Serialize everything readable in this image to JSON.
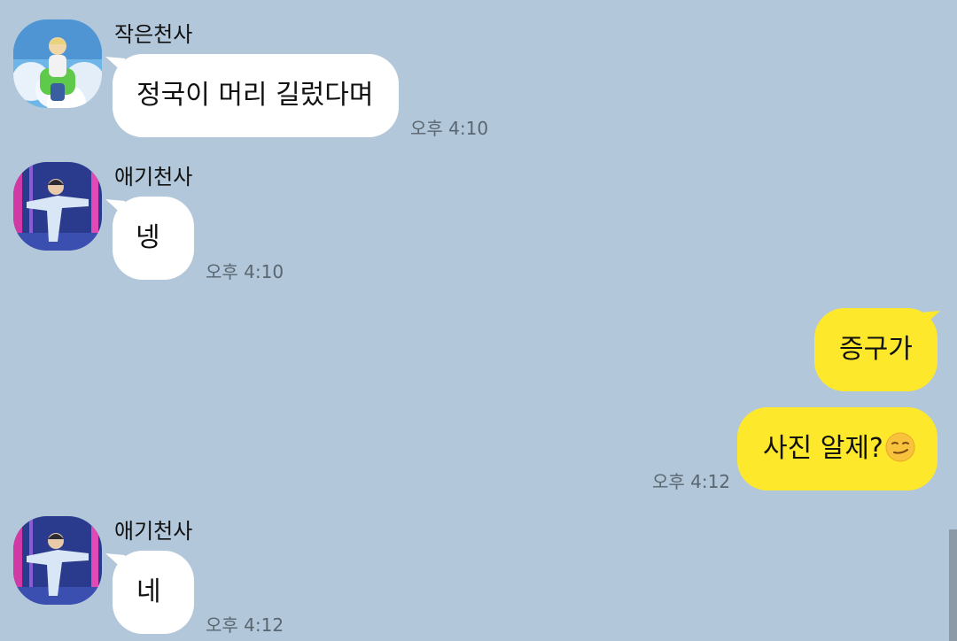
{
  "colors": {
    "background": "#b2c7d9",
    "incoming_bubble": "#ffffff",
    "outgoing_bubble": "#fee82c",
    "time_text": "#5a6670"
  },
  "messages": [
    {
      "sender": "작은천사",
      "text": "정국이 머리 길렀다며",
      "time": "오후 4:10",
      "direction": "incoming",
      "avatar": "avatar-sky-icon"
    },
    {
      "sender": "애기천사",
      "text": "넹",
      "time": "오후 4:10",
      "direction": "incoming",
      "avatar": "avatar-stage-icon"
    },
    {
      "text": "증구가",
      "direction": "outgoing"
    },
    {
      "text": "사진 알제?",
      "emoji": "smirking-face-icon",
      "time": "오후 4:12",
      "direction": "outgoing"
    },
    {
      "sender": "애기천사",
      "text": "네",
      "time": "오후 4:12",
      "direction": "incoming",
      "avatar": "avatar-stage-icon"
    }
  ]
}
